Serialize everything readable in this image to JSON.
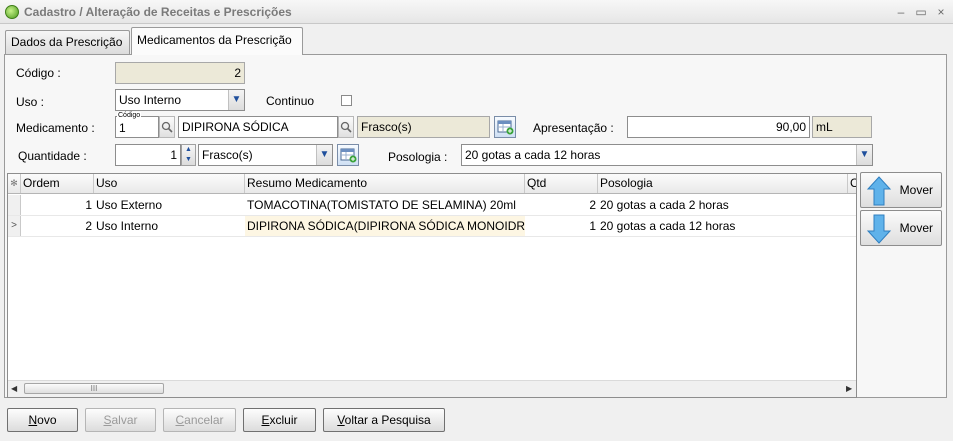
{
  "window": {
    "title": "Cadastro / Alteração de Receitas e Prescrições",
    "buttons": {
      "minimize": "–",
      "maximize": "▭",
      "close": "×"
    }
  },
  "tabs": [
    {
      "label": "Dados da Prescrição",
      "active": false
    },
    {
      "label": "Medicamentos da Prescrição",
      "active": true
    }
  ],
  "form": {
    "codigo_label": "Código :",
    "codigo_value": "2",
    "uso_label": "Uso :",
    "uso_value": "Uso Interno",
    "continuo_label": "Continuo",
    "continuo_checked": false,
    "medicamento_label": "Medicamento :",
    "medicamento_codigo_caption": "Código",
    "medicamento_codigo": "1",
    "medicamento_nome": "DIPIRONA SÓDICA",
    "medicamento_unidade": "Frasco(s)",
    "apresentacao_label": "Apresentação :",
    "apresentacao_value": "90,00",
    "apresentacao_unit": "mL",
    "quantidade_label": "Quantidade :",
    "quantidade_value": "1",
    "quantidade_unidade": "Frasco(s)",
    "posologia_label": "Posologia :",
    "posologia_value": "20 gotas a cada 12 horas"
  },
  "table": {
    "headers": [
      "Ordem",
      "Uso",
      "Resumo Medicamento",
      "Qtd",
      "Posologia",
      "C"
    ],
    "rows": [
      {
        "ordem": "1",
        "uso": "Uso Externo",
        "resumo": "TOMACOTINA(TOMISTATO DE SELAMINA) 20ml",
        "qtd": "2",
        "posologia": "20 gotas a cada 2 horas",
        "current": false
      },
      {
        "ordem": "2",
        "uso": "Uso Interno",
        "resumo": "DIPIRONA SÓDICA(DIPIRONA SÓDICA MONOIDR",
        "qtd": "1",
        "posologia": "20 gotas a cada 12 horas",
        "current": true
      }
    ],
    "scroll_thumb": "III"
  },
  "side_buttons": {
    "up_label": "Mover",
    "down_label": "Mover"
  },
  "bottom_buttons": {
    "novo": {
      "hot": "N",
      "rest": "ovo"
    },
    "salvar": {
      "hot": "S",
      "rest": "alvar"
    },
    "cancelar": {
      "hot": "C",
      "rest": "ancelar"
    },
    "excluir": {
      "hot": "E",
      "rest": "xcluir"
    },
    "voltar": {
      "hot": "V",
      "rest": "oltar a Pesquisa"
    }
  },
  "colors": {
    "accent": "#3a8fd8",
    "readonly_bg": "#ece9d8",
    "selected_cell": "#fdf6e3"
  }
}
